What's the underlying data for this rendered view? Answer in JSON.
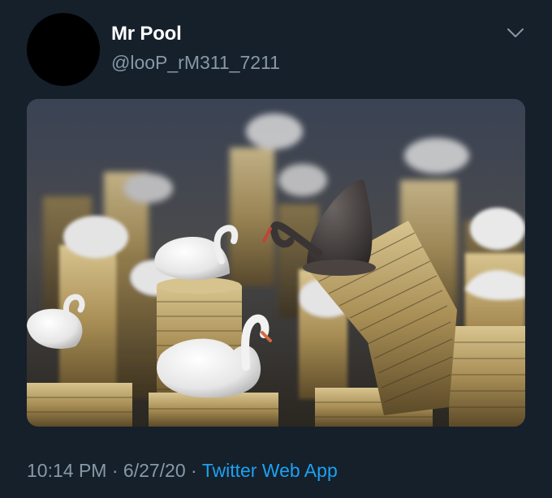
{
  "user": {
    "display_name": "Mr Pool",
    "handle": "@looP_rM311_7211"
  },
  "media": {
    "description_icon": "photo"
  },
  "meta": {
    "time": "10:14 PM",
    "separator1": " · ",
    "date": "6/27/20",
    "separator2": " · ",
    "source": "Twitter Web App"
  },
  "colors": {
    "background": "#15202b",
    "secondary_text": "#8899a6",
    "link": "#1da1f2"
  },
  "icons": {
    "menu": "chevron-down-icon"
  }
}
